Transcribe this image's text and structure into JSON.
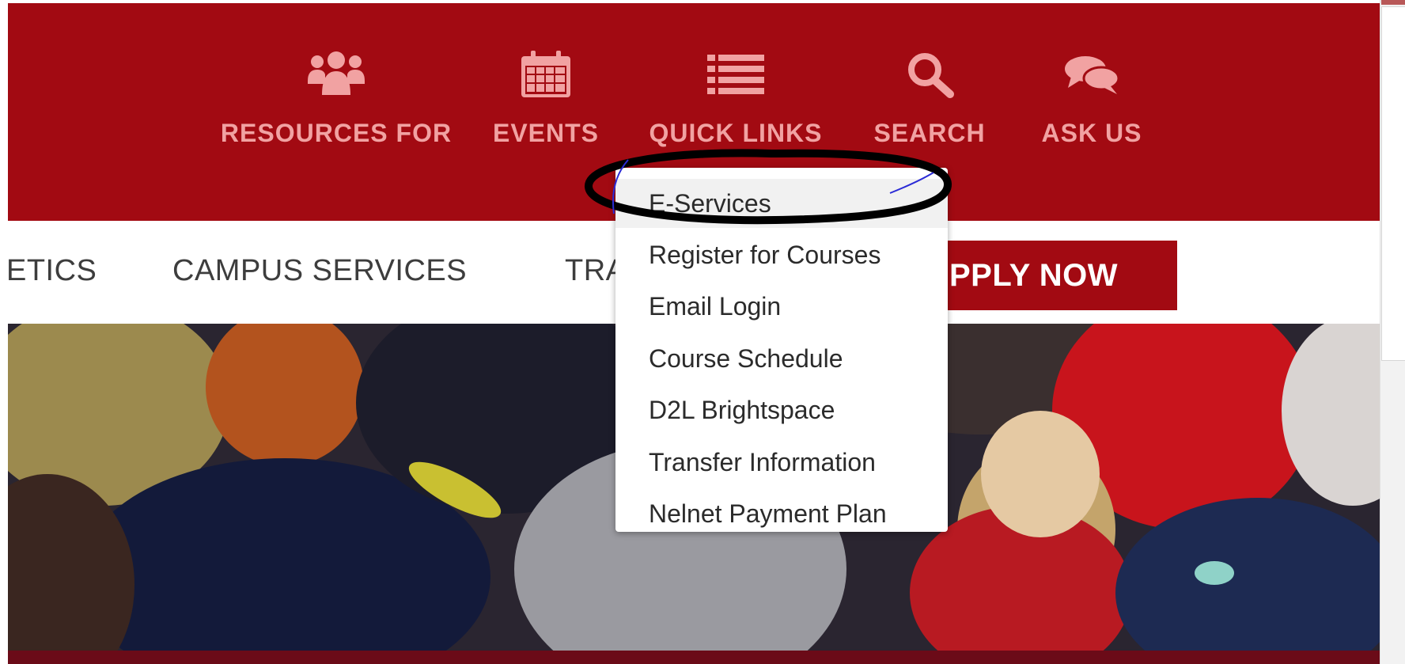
{
  "top_nav": {
    "items": [
      {
        "label": "RESOURCES FOR",
        "icon": "users-icon"
      },
      {
        "label": "EVENTS",
        "icon": "calendar-icon"
      },
      {
        "label": "QUICK LINKS",
        "icon": "list-icon"
      },
      {
        "label": "SEARCH",
        "icon": "search-icon"
      },
      {
        "label": "ASK US",
        "icon": "chat-icon"
      }
    ]
  },
  "main_nav": {
    "items": [
      {
        "label": "ETICS"
      },
      {
        "label": "CAMPUS SERVICES"
      },
      {
        "label": "TRA"
      }
    ],
    "apply_label": "PPLY NOW"
  },
  "quick_links_menu": {
    "items": [
      {
        "label": "E-Services"
      },
      {
        "label": "Register for Courses"
      },
      {
        "label": "Email Login"
      },
      {
        "label": "Course Schedule"
      },
      {
        "label": "D2L Brightspace"
      },
      {
        "label": "Transfer Information"
      },
      {
        "label": "Nelnet Payment Plan"
      }
    ]
  },
  "colors": {
    "brand_red": "#a20a12",
    "top_nav_text": "#f1a2a2",
    "nav_text": "#3d3d3d",
    "annotation": "#000000"
  }
}
